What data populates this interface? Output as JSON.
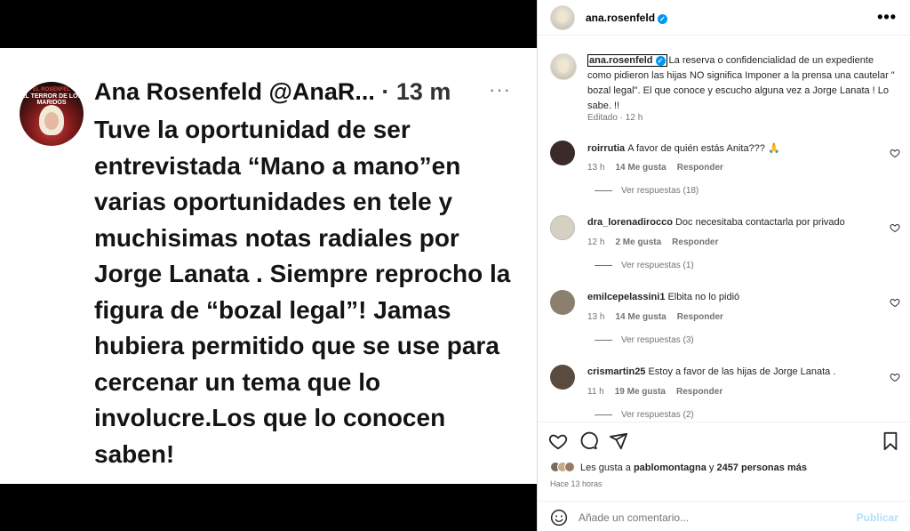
{
  "tweet": {
    "avatar_line1": "EL ROSENFEL",
    "avatar_line2": "EL TERROR DE LOS MARIDOS",
    "name": "Ana Rosenfeld",
    "handle": "@AnaR...",
    "time": "· 13 m",
    "more": "···",
    "body": "Tuve la oportunidad de ser entrevistada “Mano a mano”en varias oportunidades  en tele y muchisimas notas radiales por Jorge Lanata . Siempre reprocho la figura de “bozal legal”! Jamas hubiera permitido que se use para cercenar  un tema que lo involucre.Los que lo conocen saben!"
  },
  "header": {
    "username": "ana.rosenfeld",
    "more": "•••"
  },
  "caption": {
    "username": "ana.rosenfeld",
    "text": "La reserva o confidencialidad de un expediente como pidieron las hijas NO significa Imponer a la prensa una cautelar \" bozal legal\". El que conoce y escucho alguna vez a Jorge Lanata ! Lo sabe. !!",
    "meta": "Editado · 12 h"
  },
  "comments": [
    {
      "username": "roirrutia",
      "text": "A favor de quién estás Anita??? 🙏",
      "time": "13 h",
      "likes": "14 Me gusta",
      "reply": "Responder",
      "replies": "Ver respuestas (18)",
      "avatar_color": "#3a2a2a"
    },
    {
      "username": "dra_lorenadirocco",
      "text": "Doc necesitaba contactarla por privado",
      "time": "12 h",
      "likes": "2 Me gusta",
      "reply": "Responder",
      "replies": "Ver respuestas (1)",
      "avatar_color": "#d6d0c2"
    },
    {
      "username": "emilcepelassini1",
      "text": "Elbita no lo pidió",
      "time": "13 h",
      "likes": "14 Me gusta",
      "reply": "Responder",
      "replies": "Ver respuestas (3)",
      "avatar_color": "#8b7f6e"
    },
    {
      "username": "crismartin25",
      "text": "Estoy a favor de las hijas de Jorge Lanata .",
      "time": "11 h",
      "likes": "19 Me gusta",
      "reply": "Responder",
      "replies": "Ver respuestas (2)",
      "avatar_color": "#5b4a3e"
    }
  ],
  "likes": {
    "prefix": "Les gusta a",
    "user": "pablomontagna",
    "and": "y",
    "others": "2457 personas más"
  },
  "posted_ago": "Hace 13 horas",
  "add_comment": {
    "placeholder": "Añade un comentario...",
    "post_label": "Publicar"
  },
  "colors": {
    "verified": "#0095f6",
    "post_disabled": "#b2dffc",
    "meta": "#737373"
  }
}
